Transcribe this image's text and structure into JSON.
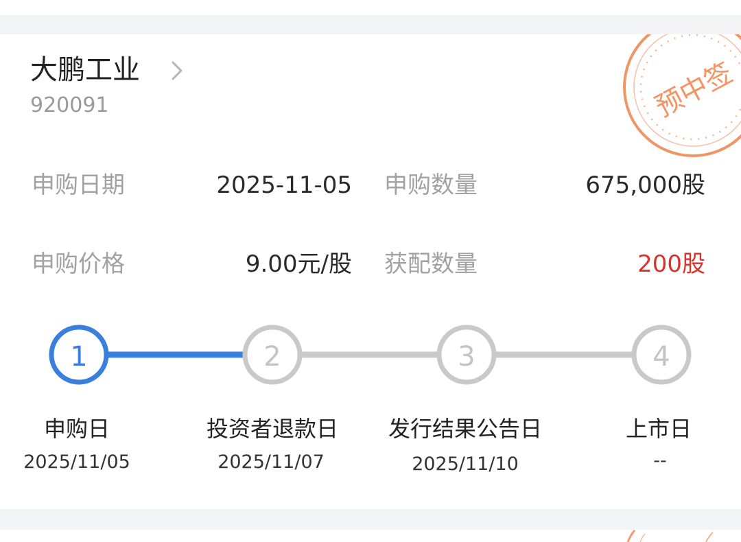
{
  "stock": {
    "name": "大鹏工业",
    "code": "920091",
    "stamp_text": "预中签"
  },
  "details": {
    "subscribe_date_label": "申购日期",
    "subscribe_date_value": "2025-11-05",
    "subscribe_qty_label": "申购数量",
    "subscribe_qty_value": "675,000股",
    "price_label": "申购价格",
    "price_value": "9.00元/股",
    "allotted_label": "获配数量",
    "allotted_value": "200股"
  },
  "steps": [
    {
      "num": "1",
      "name": "申购日",
      "date": "2025/11/05",
      "active": true
    },
    {
      "num": "2",
      "name": "投资者退款日",
      "date": "2025/11/07",
      "active": false
    },
    {
      "num": "3",
      "name": "发行结果公告日",
      "date": "2025/11/10",
      "active": false
    },
    {
      "num": "4",
      "name": "上市日",
      "date": "--",
      "active": false
    }
  ],
  "colors": {
    "active": "#3a7fdc",
    "inactive": "#c9c9c9",
    "stamp": "#f0824a",
    "highlight": "#d9332e"
  }
}
